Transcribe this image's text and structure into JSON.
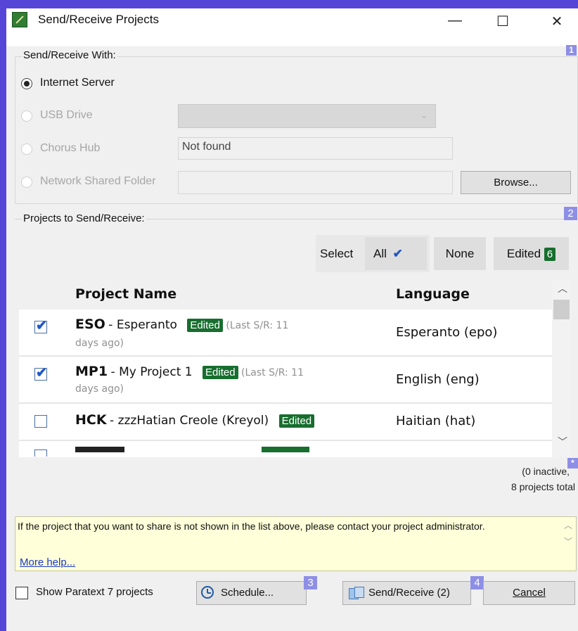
{
  "window": {
    "title": "Send/Receive Projects",
    "minimize": "—",
    "maximize": "☐",
    "close": "✕"
  },
  "send_with": {
    "label": "Send/Receive With:",
    "badge": "1",
    "options": [
      {
        "label": "Internet Server",
        "selected": true,
        "enabled": true
      },
      {
        "label": "USB Drive",
        "selected": false,
        "enabled": false
      },
      {
        "label": "Chorus Hub",
        "selected": false,
        "enabled": false
      },
      {
        "label": "Network Shared Folder",
        "selected": false,
        "enabled": false
      }
    ],
    "usb_combo_value": "",
    "chorus_value": "Not found",
    "network_value": "",
    "browse_label": "Browse..."
  },
  "projects": {
    "label": "Projects to Send/Receive:",
    "badge": "2",
    "select_label": "Select",
    "select_all": "All",
    "select_none": "None",
    "select_edited": "Edited",
    "edited_count": "6",
    "columns": {
      "name": "Project Name",
      "language": "Language"
    },
    "rows": [
      {
        "checked": true,
        "code": "ESO",
        "name": "Esperanto",
        "edited": "Edited",
        "last": "(Last S/R: 11",
        "last2": "days ago)",
        "language": "Esperanto (epo)"
      },
      {
        "checked": true,
        "code": "MP1",
        "name": "My Project 1",
        "edited": "Edited",
        "last": "(Last S/R: 11",
        "last2": "days ago)",
        "language": "English (eng)"
      },
      {
        "checked": false,
        "code": "HCK",
        "name": "zzzHatian Creole (Kreyol)",
        "edited": "Edited",
        "last": "",
        "last2": "",
        "language": "Haitian (hat)"
      }
    ],
    "inactive_text": "(0 inactive,",
    "total_text": "8 projects total",
    "star_badge": "*"
  },
  "info": {
    "text": "If the project that you want to share is not shown in the list above, please contact your project administrator.",
    "link": "More help..."
  },
  "footer": {
    "show_pt7_label": "Show Paratext 7 projects",
    "schedule_label": "Schedule...",
    "schedule_badge": "3",
    "sendreceive_label": "Send/Receive (2)",
    "sendreceive_badge": "4",
    "cancel_label": "Cancel"
  },
  "colors": {
    "frame": "#5646d8",
    "edited_badge": "#176e2e",
    "badge": "#8d8fe6",
    "link": "#1a39c6"
  }
}
